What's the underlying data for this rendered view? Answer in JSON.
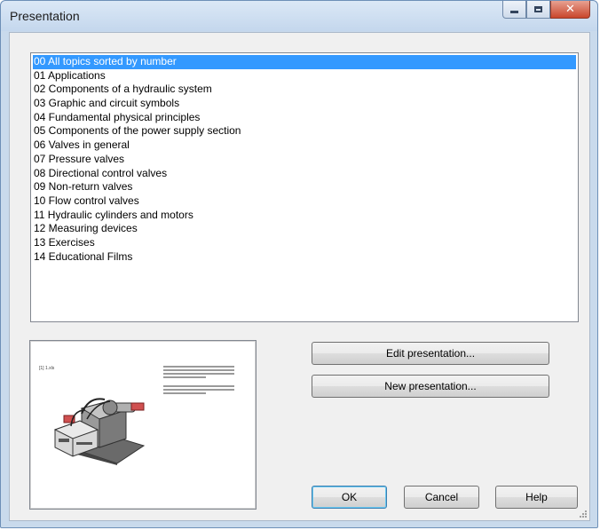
{
  "window": {
    "title": "Presentation",
    "controls": {
      "minimize": "minimize-icon",
      "maximize": "maximize-icon",
      "close": "close-icon",
      "close_glyph": "✕"
    }
  },
  "topics": {
    "selected_index": 0,
    "items": [
      "00 All topics sorted by number",
      "01 Applications",
      "02 Components of a hydraulic system",
      "03 Graphic and circuit symbols",
      "04 Fundamental physical principles",
      "05 Components of the power supply section",
      "06 Valves in general",
      "07 Pressure valves",
      "08 Directional control valves",
      "09 Non-return valves",
      "10 Flow control valves",
      "11 Hydraulic cylinders and motors",
      "12 Measuring devices",
      "13 Exercises",
      "14 Educational Films"
    ]
  },
  "preview": {
    "slide_label": "[1] 1.xls",
    "image": "hydraulic-machine-illustration"
  },
  "buttons": {
    "edit": "Edit presentation...",
    "new": "New presentation...",
    "ok": "OK",
    "cancel": "Cancel",
    "help": "Help"
  },
  "colors": {
    "selection": "#3399ff",
    "accent_red": "#d05050",
    "title_bar": "#c4d7ed"
  }
}
